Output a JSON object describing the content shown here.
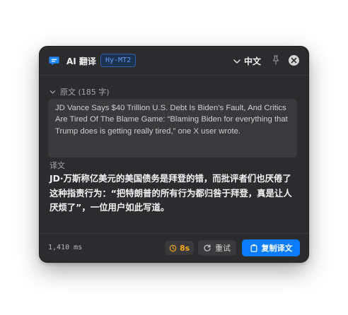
{
  "window": {
    "app_title": "AI 翻译",
    "model_badge": "Hy-MT2",
    "target_language": "中文"
  },
  "source": {
    "label": "原文 (185 字)",
    "text": "JD Vance Says $40 Trillion U.S. Debt Is Biden’s Fault, And Critics Are Tired Of The Blame Game: “Blaming Biden for everything that Trump does is getting really tired,” one X user wrote."
  },
  "translation": {
    "label": "译文",
    "text": "JD·万斯称亿美元的美国债务是拜登的错，而批评者们也厌倦了这种指责行为：“把特朗普的所有行为都归咎于拜登，真是让人厌烦了”，一位用户如此写道。"
  },
  "footer": {
    "latency": "1,410 ms",
    "timer": "8s",
    "retry_label": "重试",
    "copy_label": "复制译文"
  },
  "colors": {
    "window_bg": "#2c2c2e",
    "accent_blue": "#0a7cff",
    "badge_blue": "#5a9bf6",
    "timer_orange": "#f5a623"
  },
  "icons": {
    "app": "chat-bubble-icon",
    "language": "chevron-down-icon",
    "pin": "pin-icon",
    "close": "close-icon",
    "source_toggle": "chevron-down-icon",
    "timer": "clock-icon",
    "retry": "refresh-icon",
    "copy": "copy-icon"
  }
}
